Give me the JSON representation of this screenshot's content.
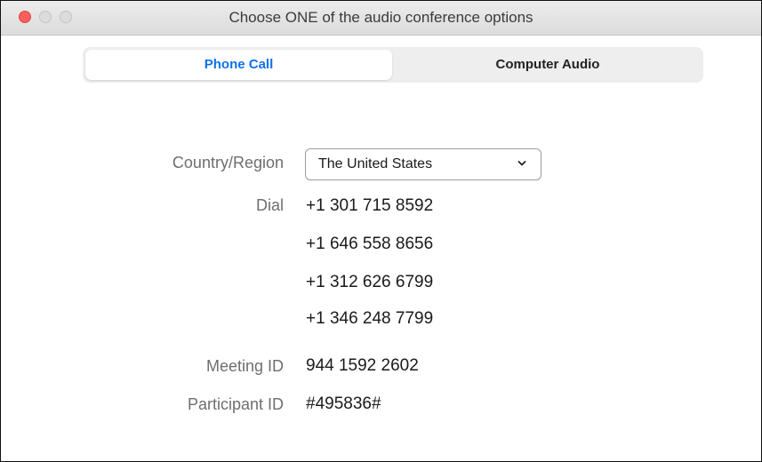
{
  "window": {
    "title": "Choose ONE of the audio conference options"
  },
  "tabs": [
    {
      "label": "Phone Call",
      "active": true
    },
    {
      "label": "Computer Audio",
      "active": false
    }
  ],
  "form": {
    "country_label": "Country/Region",
    "country_value": "The United States",
    "dial_label": "Dial",
    "dial_numbers": [
      "+1 301 715 8592",
      "+1 646 558 8656",
      "+1 312 626 6799",
      "+1 346 248 7799"
    ],
    "meeting_id_label": "Meeting ID",
    "meeting_id_value": "944 1592 2602",
    "participant_id_label": "Participant ID",
    "participant_id_value": "#495836#"
  },
  "icons": {
    "dropdown": "chevron-down-icon"
  },
  "colors": {
    "accent": "#0e71eb",
    "close_button": "#fc605c"
  }
}
